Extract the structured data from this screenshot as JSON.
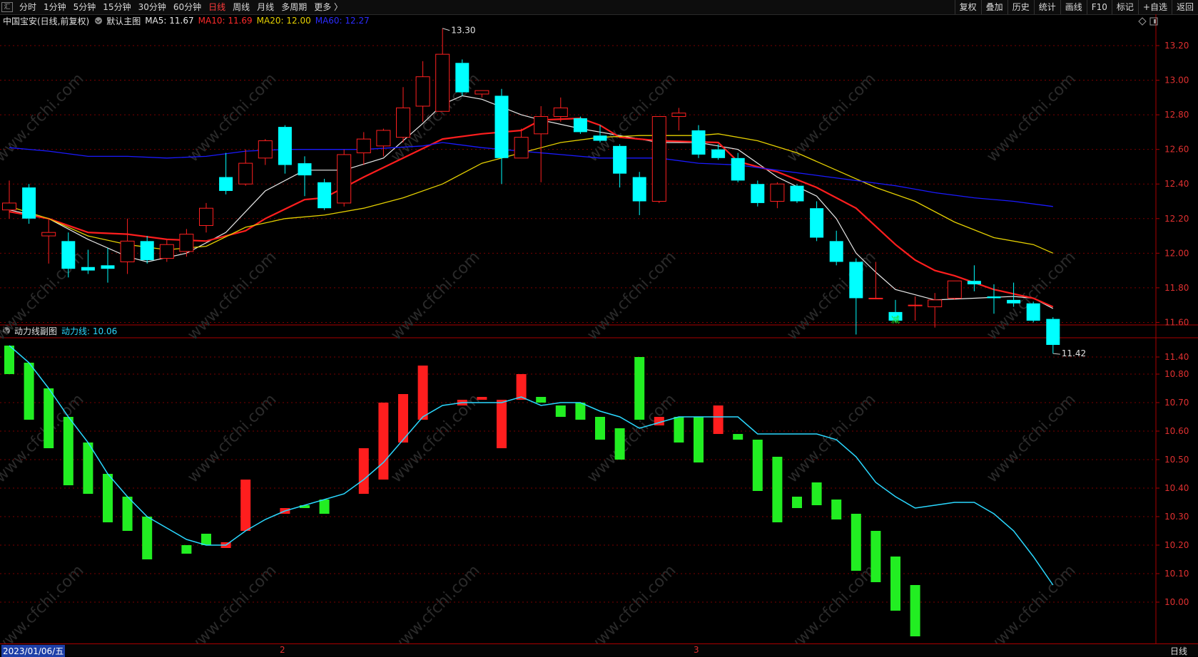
{
  "toolbar": {
    "logo": "汇",
    "left_items": [
      "分时",
      "1分钟",
      "5分钟",
      "15分钟",
      "30分钟",
      "60分钟",
      "日线",
      "周线",
      "月线",
      "多周期",
      "更多 〉"
    ],
    "active": "日线",
    "right_items": [
      "复权",
      "叠加",
      "历史",
      "统计",
      "画线",
      "F10",
      "标记",
      "+自选",
      "返回"
    ]
  },
  "main_info": {
    "stock": "中国宝安(日线,前复权)",
    "template": "默认主图",
    "ma5": "MA5: 11.67",
    "ma10": "MA10: 11.69",
    "ma20": "MA20: 12.00",
    "ma60": "MA60: 12.27"
  },
  "sub_info": {
    "name": "动力线副图",
    "line": "动力线: 10.06"
  },
  "bottom": {
    "date": "2023/01/06/五",
    "month_marks": [
      "2",
      "3"
    ],
    "period": "日线"
  },
  "annotations": {
    "high": "13.30",
    "low": "11.42",
    "signal": "减"
  },
  "watermark": "www.cfchi.com",
  "colors": {
    "up": "#ff2020",
    "down": "#00ffff",
    "ma5": "#e8e8e8",
    "ma10": "#ff1e1e",
    "ma20": "#e5d000",
    "ma60": "#1a1aff",
    "power_line": "#2ad8ff",
    "bar_up": "#ff1e1e",
    "bar_down": "#22ee22",
    "grid": "#7a0000"
  },
  "chart_data": [
    {
      "type": "candlestick",
      "title": "中国宝安(日线,前复权)",
      "y_ticks": [
        "13.20",
        "13.00",
        "12.80",
        "12.60",
        "12.40",
        "12.20",
        "12.00",
        "11.80",
        "11.60",
        "11.40"
      ],
      "ylim": [
        11.36,
        13.35
      ],
      "candles": [
        {
          "o": 12.25,
          "c": 12.29,
          "h": 12.42,
          "l": 12.2
        },
        {
          "o": 12.38,
          "c": 12.2,
          "h": 12.4,
          "l": 12.17
        },
        {
          "o": 12.1,
          "c": 12.12,
          "h": 12.2,
          "l": 11.94
        },
        {
          "o": 12.07,
          "c": 11.91,
          "h": 12.12,
          "l": 11.86
        },
        {
          "o": 11.92,
          "c": 11.9,
          "h": 12.02,
          "l": 11.88
        },
        {
          "o": 11.93,
          "c": 11.91,
          "h": 12.03,
          "l": 11.83
        },
        {
          "o": 11.95,
          "c": 12.07,
          "h": 12.2,
          "l": 11.88
        },
        {
          "o": 12.07,
          "c": 11.96,
          "h": 12.1,
          "l": 11.94
        },
        {
          "o": 11.97,
          "c": 12.05,
          "h": 12.08,
          "l": 11.95
        },
        {
          "o": 12.01,
          "c": 12.11,
          "h": 12.14,
          "l": 11.98
        },
        {
          "o": 12.16,
          "c": 12.26,
          "h": 12.29,
          "l": 12.12
        },
        {
          "o": 12.44,
          "c": 12.36,
          "h": 12.58,
          "l": 12.34
        },
        {
          "o": 12.4,
          "c": 12.52,
          "h": 12.6,
          "l": 12.39
        },
        {
          "o": 12.55,
          "c": 12.65,
          "h": 12.66,
          "l": 12.51
        },
        {
          "o": 12.73,
          "c": 12.51,
          "h": 12.74,
          "l": 12.46
        },
        {
          "o": 12.52,
          "c": 12.45,
          "h": 12.56,
          "l": 12.33
        },
        {
          "o": 12.41,
          "c": 12.26,
          "h": 12.43,
          "l": 12.25
        },
        {
          "o": 12.29,
          "c": 12.57,
          "h": 12.6,
          "l": 12.27
        },
        {
          "o": 12.58,
          "c": 12.66,
          "h": 12.7,
          "l": 12.51
        },
        {
          "o": 12.62,
          "c": 12.71,
          "h": 12.72,
          "l": 12.56
        },
        {
          "o": 12.67,
          "c": 12.84,
          "h": 12.96,
          "l": 12.64
        },
        {
          "o": 12.85,
          "c": 13.02,
          "h": 13.11,
          "l": 12.76
        },
        {
          "o": 12.82,
          "c": 13.15,
          "h": 13.3,
          "l": 12.82
        },
        {
          "o": 13.1,
          "c": 12.93,
          "h": 13.12,
          "l": 12.91
        },
        {
          "o": 12.92,
          "c": 12.94,
          "h": 12.94,
          "l": 12.9
        },
        {
          "o": 12.91,
          "c": 12.55,
          "h": 12.95,
          "l": 12.4
        },
        {
          "o": 12.55,
          "c": 12.67,
          "h": 12.72,
          "l": 12.55
        },
        {
          "o": 12.69,
          "c": 12.79,
          "h": 12.85,
          "l": 12.41
        },
        {
          "o": 12.79,
          "c": 12.84,
          "h": 12.9,
          "l": 12.76
        },
        {
          "o": 12.78,
          "c": 12.7,
          "h": 12.79,
          "l": 12.69
        },
        {
          "o": 12.68,
          "c": 12.65,
          "h": 12.74,
          "l": 12.64
        },
        {
          "o": 12.62,
          "c": 12.46,
          "h": 12.63,
          "l": 12.38
        },
        {
          "o": 12.44,
          "c": 12.3,
          "h": 12.47,
          "l": 12.22
        },
        {
          "o": 12.3,
          "c": 12.79,
          "h": 12.79,
          "l": 12.29
        },
        {
          "o": 12.79,
          "c": 12.81,
          "h": 12.84,
          "l": 12.71
        },
        {
          "o": 12.71,
          "c": 12.57,
          "h": 12.74,
          "l": 12.55
        },
        {
          "o": 12.6,
          "c": 12.55,
          "h": 12.63,
          "l": 12.54
        },
        {
          "o": 12.55,
          "c": 12.42,
          "h": 12.58,
          "l": 12.41
        },
        {
          "o": 12.4,
          "c": 12.29,
          "h": 12.42,
          "l": 12.27
        },
        {
          "o": 12.3,
          "c": 12.4,
          "h": 12.41,
          "l": 12.26
        },
        {
          "o": 12.39,
          "c": 12.3,
          "h": 12.4,
          "l": 12.29
        },
        {
          "o": 12.26,
          "c": 12.09,
          "h": 12.3,
          "l": 12.07
        },
        {
          "o": 12.07,
          "c": 11.95,
          "h": 12.13,
          "l": 11.93
        },
        {
          "o": 11.95,
          "c": 11.74,
          "h": 11.97,
          "l": 11.53
        },
        {
          "o": 11.74,
          "c": 11.74,
          "h": 11.95,
          "l": 11.74
        },
        {
          "o": 11.66,
          "c": 11.61,
          "h": 11.73,
          "l": 11.6
        },
        {
          "o": 11.7,
          "c": 11.7,
          "h": 11.75,
          "l": 11.61
        },
        {
          "o": 11.69,
          "c": 11.73,
          "h": 11.77,
          "l": 11.57
        },
        {
          "o": 11.74,
          "c": 11.84,
          "h": 11.84,
          "l": 11.73
        },
        {
          "o": 11.84,
          "c": 11.82,
          "h": 11.93,
          "l": 11.78
        },
        {
          "o": 11.75,
          "c": 11.74,
          "h": 11.82,
          "l": 11.65
        },
        {
          "o": 11.73,
          "c": 11.71,
          "h": 11.83,
          "l": 11.69
        },
        {
          "o": 11.71,
          "c": 11.61,
          "h": 11.72,
          "l": 11.6
        },
        {
          "o": 11.62,
          "c": 11.47,
          "h": 11.63,
          "l": 11.42
        }
      ],
      "ma_series": [
        {
          "name": "MA5",
          "points": [
            [
              0,
              12.25
            ],
            [
              2,
              12.2
            ],
            [
              4,
              12.08
            ],
            [
              6,
              11.98
            ],
            [
              7,
              11.95
            ],
            [
              9,
              12.0
            ],
            [
              11,
              12.12
            ],
            [
              13,
              12.36
            ],
            [
              15,
              12.48
            ],
            [
              17,
              12.48
            ],
            [
              19,
              12.55
            ],
            [
              21,
              12.75
            ],
            [
              22,
              12.86
            ],
            [
              23,
              12.91
            ],
            [
              24,
              12.89
            ],
            [
              26,
              12.8
            ],
            [
              27,
              12.77
            ],
            [
              29,
              12.72
            ],
            [
              31,
              12.68
            ],
            [
              33,
              12.64
            ],
            [
              35,
              12.64
            ],
            [
              37,
              12.6
            ],
            [
              39,
              12.44
            ],
            [
              41,
              12.33
            ],
            [
              42,
              12.2
            ],
            [
              43,
              12.0
            ],
            [
              44,
              11.89
            ],
            [
              45,
              11.79
            ],
            [
              47,
              11.73
            ],
            [
              49,
              11.74
            ],
            [
              51,
              11.75
            ],
            [
              52,
              11.74
            ],
            [
              53,
              11.68
            ]
          ]
        },
        {
          "name": "MA10",
          "points": [
            [
              0,
              12.24
            ],
            [
              2,
              12.2
            ],
            [
              4,
              12.12
            ],
            [
              6,
              12.11
            ],
            [
              8,
              12.08
            ],
            [
              10,
              12.07
            ],
            [
              12,
              12.13
            ],
            [
              13,
              12.2
            ],
            [
              15,
              12.31
            ],
            [
              16,
              12.32
            ],
            [
              18,
              12.44
            ],
            [
              20,
              12.55
            ],
            [
              22,
              12.66
            ],
            [
              24,
              12.69
            ],
            [
              26,
              12.71
            ],
            [
              27,
              12.77
            ],
            [
              29,
              12.78
            ],
            [
              30,
              12.74
            ],
            [
              31,
              12.67
            ],
            [
              33,
              12.65
            ],
            [
              36,
              12.64
            ],
            [
              37,
              12.53
            ],
            [
              39,
              12.47
            ],
            [
              41,
              12.38
            ],
            [
              43,
              12.26
            ],
            [
              45,
              12.05
            ],
            [
              46,
              11.96
            ],
            [
              47,
              11.9
            ],
            [
              48,
              11.87
            ],
            [
              50,
              11.79
            ],
            [
              52,
              11.74
            ],
            [
              53,
              11.69
            ]
          ]
        },
        {
          "name": "MA20",
          "points": [
            [
              0,
              12.27
            ],
            [
              2,
              12.2
            ],
            [
              4,
              12.1
            ],
            [
              6,
              12.05
            ],
            [
              8,
              12.02
            ],
            [
              10,
              12.04
            ],
            [
              12,
              12.15
            ],
            [
              14,
              12.2
            ],
            [
              16,
              12.22
            ],
            [
              18,
              12.26
            ],
            [
              20,
              12.32
            ],
            [
              22,
              12.4
            ],
            [
              24,
              12.52
            ],
            [
              26,
              12.58
            ],
            [
              28,
              12.64
            ],
            [
              30,
              12.67
            ],
            [
              32,
              12.68
            ],
            [
              35,
              12.68
            ],
            [
              36,
              12.69
            ],
            [
              38,
              12.65
            ],
            [
              40,
              12.58
            ],
            [
              42,
              12.48
            ],
            [
              44,
              12.38
            ],
            [
              46,
              12.3
            ],
            [
              48,
              12.18
            ],
            [
              50,
              12.09
            ],
            [
              52,
              12.05
            ],
            [
              53,
              12.0
            ]
          ]
        },
        {
          "name": "MA60",
          "points": [
            [
              0,
              12.61
            ],
            [
              2,
              12.59
            ],
            [
              4,
              12.56
            ],
            [
              6,
              12.56
            ],
            [
              8,
              12.55
            ],
            [
              10,
              12.56
            ],
            [
              12,
              12.59
            ],
            [
              14,
              12.6
            ],
            [
              18,
              12.6
            ],
            [
              21,
              12.62
            ],
            [
              22,
              12.64
            ],
            [
              24,
              12.61
            ],
            [
              26,
              12.59
            ],
            [
              28,
              12.57
            ],
            [
              30,
              12.55
            ],
            [
              33,
              12.55
            ],
            [
              35,
              12.52
            ],
            [
              37,
              12.51
            ],
            [
              39,
              12.48
            ],
            [
              41,
              12.45
            ],
            [
              43,
              12.42
            ],
            [
              45,
              12.39
            ],
            [
              47,
              12.35
            ],
            [
              49,
              12.32
            ],
            [
              51,
              12.3
            ],
            [
              53,
              12.27
            ]
          ]
        }
      ]
    },
    {
      "type": "bar+line",
      "title": "动力线副图",
      "y_ticks": [
        "10.80",
        "10.70",
        "10.60",
        "10.50",
        "10.40",
        "10.30",
        "10.20",
        "10.10",
        "10.00"
      ],
      "ylim": [
        9.88,
        10.96
      ],
      "power_line": [
        10.9,
        10.84,
        10.75,
        10.65,
        10.56,
        10.45,
        10.37,
        10.3,
        10.26,
        10.22,
        10.2,
        10.2,
        10.25,
        10.29,
        10.32,
        10.34,
        10.36,
        10.38,
        10.43,
        10.49,
        10.57,
        10.65,
        10.69,
        10.7,
        10.7,
        10.7,
        10.72,
        10.69,
        10.7,
        10.7,
        10.67,
        10.65,
        10.61,
        10.63,
        10.65,
        10.65,
        10.65,
        10.65,
        10.59,
        10.59,
        10.59,
        10.59,
        10.57,
        10.51,
        10.42,
        10.37,
        10.33,
        10.34,
        10.35,
        10.35,
        10.31,
        10.25,
        10.16,
        10.06
      ],
      "bars": [
        {
          "from": 10.8,
          "to": 10.9
        },
        {
          "from": 10.64,
          "to": 10.84
        },
        {
          "from": 10.54,
          "to": 10.75
        },
        {
          "from": 10.41,
          "to": 10.65
        },
        {
          "from": 10.38,
          "to": 10.56
        },
        {
          "from": 10.28,
          "to": 10.45
        },
        {
          "from": 10.25,
          "to": 10.37
        },
        {
          "from": 10.15,
          "to": 10.3
        },
        {
          "from": 10.17,
          "to": 10.2
        },
        {
          "from": 10.2,
          "to": 10.24
        },
        {
          "from": 10.19,
          "to": 10.21
        },
        {
          "from": 10.25,
          "to": 10.43
        },
        {
          "from": 10.31,
          "to": 10.33
        },
        {
          "from": 10.33,
          "to": 10.34
        },
        {
          "from": 10.31,
          "to": 10.36
        },
        {
          "from": 10.38,
          "to": 10.54
        },
        {
          "from": 10.43,
          "to": 10.7
        },
        {
          "from": 10.56,
          "to": 10.73
        },
        {
          "from": 10.64,
          "to": 10.83
        },
        {
          "from": 10.69,
          "to": 10.71
        },
        {
          "from": 10.71,
          "to": 10.72
        },
        {
          "from": 10.54,
          "to": 10.71
        },
        {
          "from": 10.71,
          "to": 10.8
        },
        {
          "from": 10.7,
          "to": 10.72
        },
        {
          "from": 10.65,
          "to": 10.69
        },
        {
          "from": 10.64,
          "to": 10.7
        },
        {
          "from": 10.57,
          "to": 10.65
        },
        {
          "from": 10.5,
          "to": 10.61
        },
        {
          "from": 10.64,
          "to": 10.86
        },
        {
          "from": 10.62,
          "to": 10.65
        },
        {
          "from": 10.56,
          "to": 10.65
        },
        {
          "from": 10.49,
          "to": 10.65
        },
        {
          "from": 10.59,
          "to": 10.69
        },
        {
          "from": 10.57,
          "to": 10.59
        },
        {
          "from": 10.39,
          "to": 10.57
        },
        {
          "from": 10.28,
          "to": 10.51
        },
        {
          "from": 10.33,
          "to": 10.37
        },
        {
          "from": 10.34,
          "to": 10.42
        },
        {
          "from": 10.29,
          "to": 10.36
        },
        {
          "from": 10.11,
          "to": 10.31
        },
        {
          "from": 10.07,
          "to": 10.25
        },
        {
          "from": 9.97,
          "to": 10.16
        },
        {
          "from": 9.88,
          "to": 10.06
        }
      ]
    }
  ]
}
